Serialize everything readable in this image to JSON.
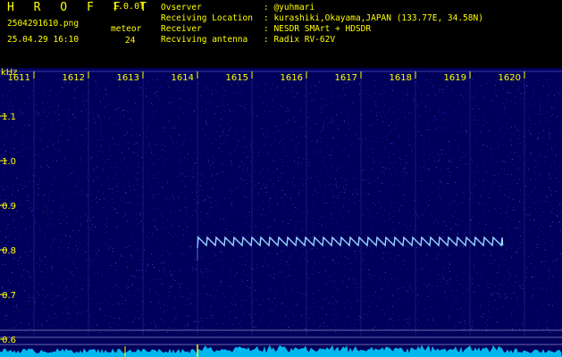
{
  "header": {
    "app_title": "H R O F F T",
    "version": "1.0.0f",
    "filename": "2504291610.png",
    "datetime": "25.04.29 16:10",
    "mode_label": "meteor",
    "count": "24",
    "info": [
      {
        "key": "Ovserver",
        "value": ": @yuhmari"
      },
      {
        "key": "Receiving Location",
        "value": ": kurashiki,Okayama,JAPAN (133.77E, 34.58N)"
      },
      {
        "key": "Receiver",
        "value": ": NESDR SMArt + HDSDR"
      },
      {
        "key": "Recviving antenna",
        "value": ": Radix RV-62V"
      }
    ]
  },
  "colors": {
    "background": "#00005a",
    "grid": "#3a3aaa",
    "text": "#ffff00",
    "signal": "#9ad6ff",
    "spectrum": "#00ccff"
  },
  "chart_data": {
    "type": "heatmap",
    "ylabel": "kHz",
    "x_ticks": [
      "1611",
      "1612",
      "1613",
      "1614",
      "1615",
      "1616",
      "1617",
      "1618",
      "1619",
      "1620"
    ],
    "y_ticks": [
      "1.1",
      "1.0",
      "0.9",
      "0.8",
      "0.7",
      "0.6"
    ],
    "ylim": [
      0.6,
      1.1
    ],
    "echo": {
      "start_tick": 1614,
      "end_tick": 1619.6,
      "freq_khz": 0.82
    }
  }
}
